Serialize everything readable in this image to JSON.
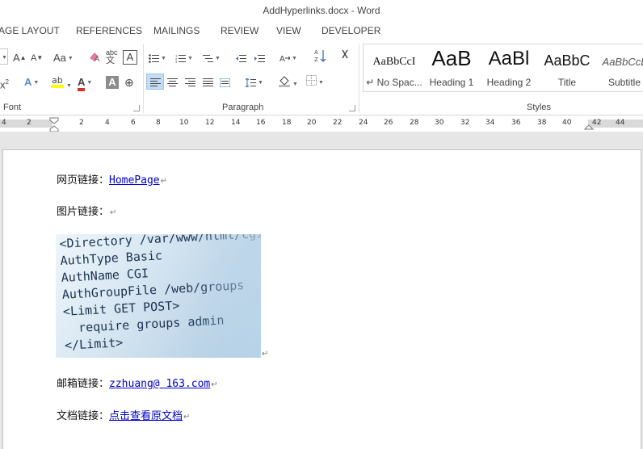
{
  "window": {
    "title": "AddHyperlinks.docx - Word"
  },
  "tabs": [
    "AGE LAYOUT",
    "REFERENCES",
    "MAILINGS",
    "REVIEW",
    "VIEW",
    "DEVELOPER"
  ],
  "ribbon": {
    "groups": {
      "font": "Font",
      "paragraph": "Paragraph",
      "styles": "Styles"
    },
    "font_buttons": {
      "case": "Aa",
      "grow": "A",
      "shrink": "A",
      "superscript": "x",
      "text_effects": "A",
      "font_color": "A"
    },
    "styles": [
      {
        "sample": "AaBbCcI",
        "name": "↵ No Spac..."
      },
      {
        "sample": "AaB",
        "name": "Heading 1"
      },
      {
        "sample": "AaBl",
        "name": "Heading 2"
      },
      {
        "sample": "AaBbC",
        "name": "Title"
      },
      {
        "sample": "AaBbCcL",
        "name": "Subtitle"
      }
    ]
  },
  "ruler": {
    "numbers": [
      "4",
      "2",
      "2",
      "4",
      "6",
      "8",
      "10",
      "12",
      "14",
      "16",
      "18",
      "20",
      "22",
      "24",
      "26",
      "28",
      "30",
      "32",
      "34",
      "36",
      "38",
      "40",
      "42",
      "44"
    ]
  },
  "document": {
    "web_link_label": "网页链接：",
    "web_link_text": "HomePage",
    "image_link_label": "图片链接：",
    "image_code_lines": "<Directory /var/www/html/cgi\nAuthType Basic\nAuthName CGI\nAuthGroupFile /web/groups\n<Limit GET POST>\n  require groups admin\n</Limit>",
    "email_link_label": "邮箱链接：",
    "email_link_text": "zzhuang@ 163.com",
    "doc_link_label": "文档链接：",
    "doc_link_text": "点击查看原文档",
    "paragraph_mark": "↵"
  }
}
